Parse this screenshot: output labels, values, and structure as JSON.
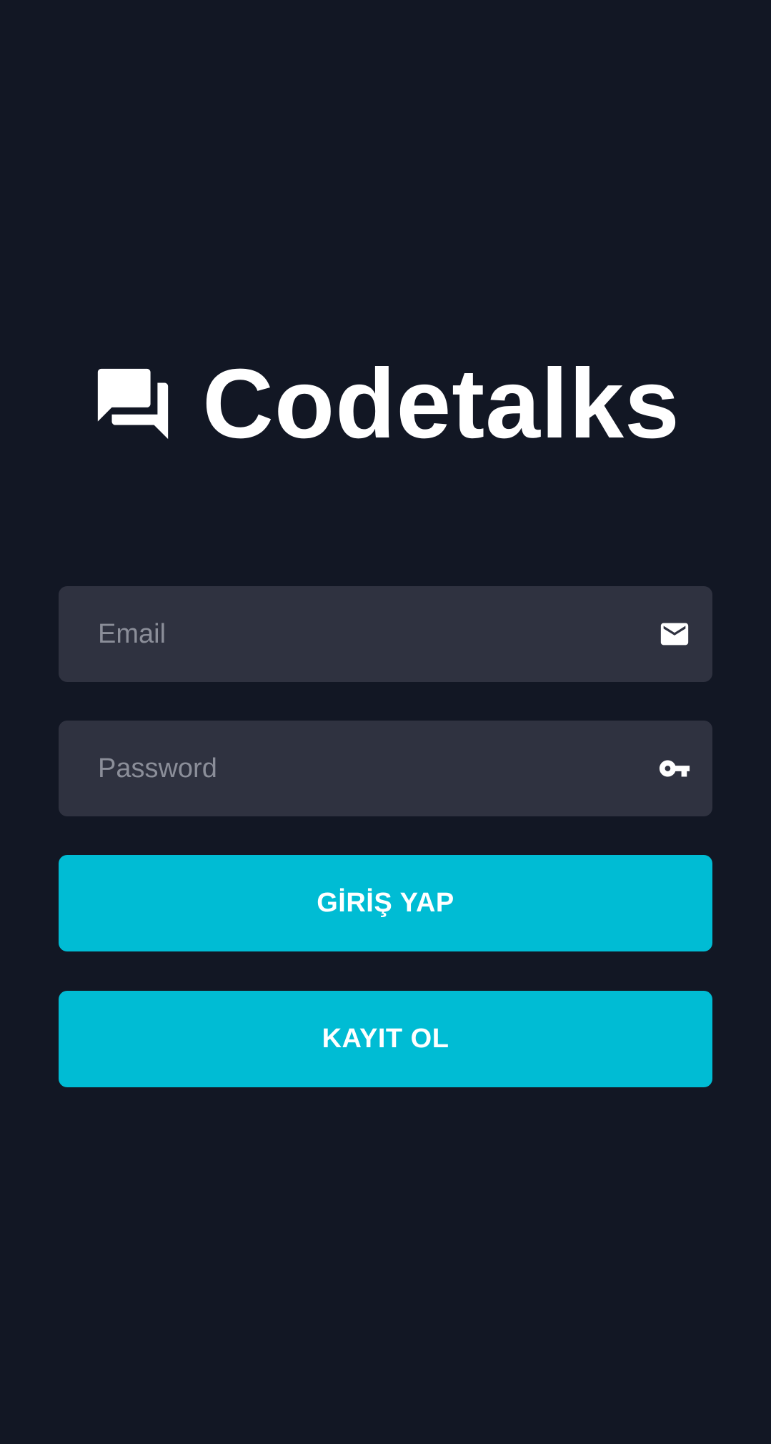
{
  "app": {
    "name": "Codetalks",
    "logo_icon": "forum-icon"
  },
  "form": {
    "email": {
      "placeholder": "Email",
      "value": "",
      "icon": "email-icon"
    },
    "password": {
      "placeholder": "Password",
      "value": "",
      "icon": "key-icon"
    }
  },
  "buttons": {
    "login_label": "GİRİŞ YAP",
    "register_label": "KAYIT OL"
  },
  "colors": {
    "background": "#121724",
    "input_background": "#2f3240",
    "accent": "#00bcd4",
    "text": "#ffffff",
    "placeholder": "#8b8e99"
  }
}
